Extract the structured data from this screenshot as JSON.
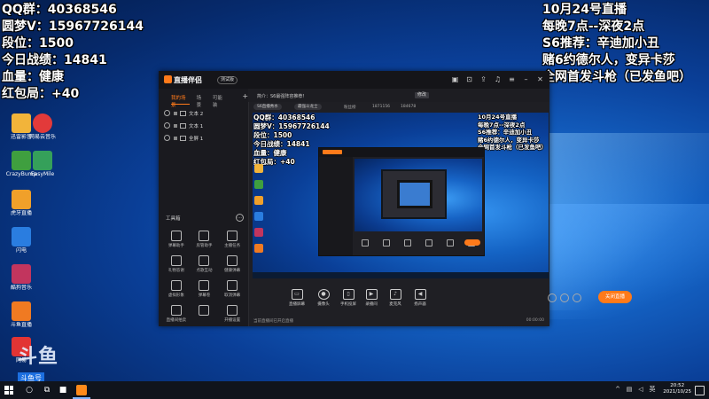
{
  "overlay_left": [
    "QQ群：40368546",
    "圆梦V：15967726144",
    "段位：1500",
    "今日战绩：14841",
    "血量：健康",
    "红包局：+40"
  ],
  "overlay_right": [
    "10月24号直播",
    "每晚7点--深夜2点",
    "S6推荐：辛迪加小丑",
    "赌6约德尔人，变异卡莎",
    "全网首发斗枪（已发鱼吧）"
  ],
  "desktop_icons": [
    {
      "label": "迅雷影音",
      "color": "#f2b43a"
    },
    {
      "label": "网易云音乐",
      "color": "#e23a3a"
    },
    {
      "label": "CrazyBump",
      "color": "#3f9f3f"
    },
    {
      "label": "EasyMile",
      "color": "#35a05a"
    },
    {
      "label": "虎牙直播",
      "color": "#f0a02a"
    },
    {
      "label": "闪电",
      "color": "#2a7de0"
    },
    {
      "label": "酷狗音乐",
      "color": "#c2355e"
    },
    {
      "label": "斗鱼直播",
      "color": "#f07a22"
    },
    {
      "label": "网易",
      "color": "#e23434"
    }
  ],
  "watermark": {
    "logo": "斗鱼",
    "tag": "斗鱼号",
    "number": "1871168"
  },
  "app": {
    "name": "直播伴侣",
    "badge": "测试版",
    "tabs": [
      "我的场景",
      "场景",
      "可能装"
    ],
    "sources": [
      "文本 2",
      "文本 1",
      "全屏 1"
    ],
    "tools_title": "工具箱",
    "tools": [
      "弹幕助手",
      "房管助手",
      "主播任务",
      "礼物答谢",
      "点歌互动",
      "健康弹幕",
      "虚拟形象",
      "弹幕卷",
      "取消弹幕",
      "直播间拍卖",
      "",
      "开播设置"
    ],
    "announcement": "简介：S6最强阵容推荐！",
    "announcement_btn": "修改",
    "pills": [
      "S6直播秀水",
      "最强斗龙士"
    ],
    "stats": [
      "粉丝榜",
      "1871156",
      "184678"
    ],
    "controls": [
      {
        "label": "直播屏幕",
        "icon": "screen-icon"
      },
      {
        "label": "摄像头",
        "icon": "camera-icon"
      },
      {
        "label": "手机投屏",
        "icon": "phone-icon"
      },
      {
        "label": "录播间",
        "icon": "record-icon"
      },
      {
        "label": "麦克风",
        "icon": "mic-icon"
      },
      {
        "label": "扬声器",
        "icon": "speaker-icon"
      }
    ],
    "go_live": "关闭直播",
    "status_text": "当前直播间已开启直播",
    "timer": "00:00:00"
  },
  "preview": {
    "left": [
      "QQ群：40368546",
      "圆梦V：15967726144",
      "段位：1500",
      "今日战绩：14841",
      "血量：健康",
      "红包局：+40"
    ],
    "right": [
      "10月24号直播",
      "每晚7点--深夜2点",
      "S6推荐：辛迪加小丑",
      "赌6约德尔人，变异卡莎",
      "全网首发斗枪（已发鱼吧）"
    ]
  },
  "taskbar": {
    "time": "20:52",
    "date": "2021/10/25"
  }
}
